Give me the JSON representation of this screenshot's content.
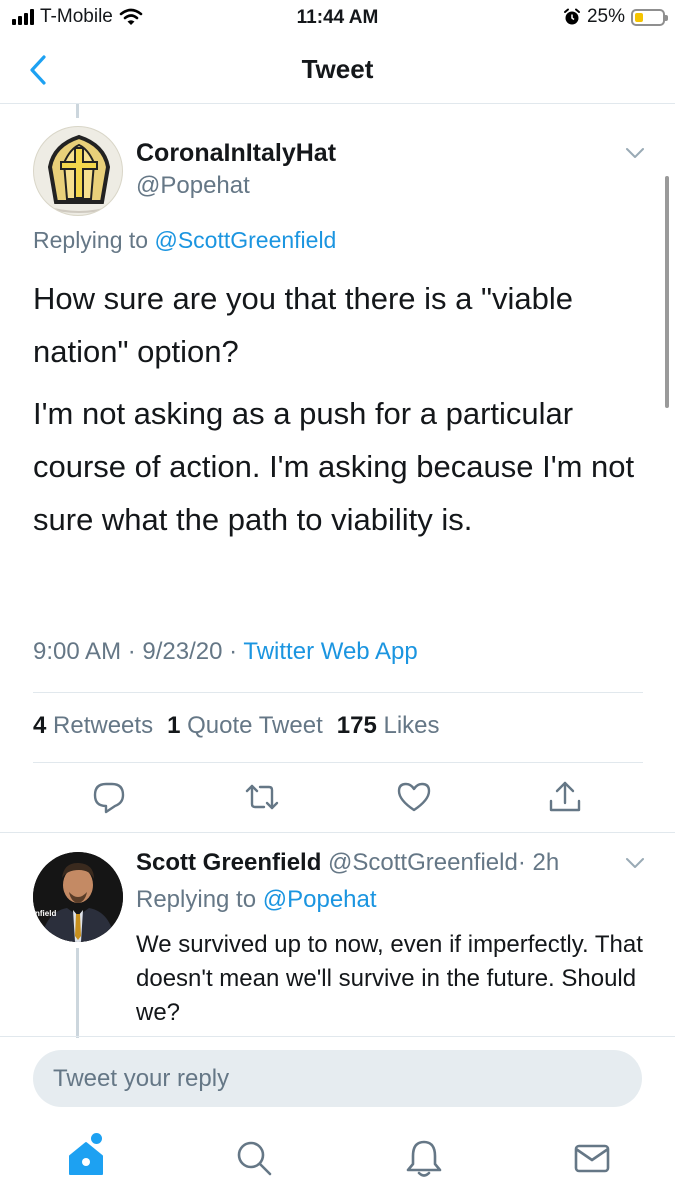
{
  "status_bar": {
    "carrier": "T-Mobile",
    "time": "11:44 AM",
    "battery": "25%",
    "battery_level": 0.25
  },
  "header": {
    "title": "Tweet"
  },
  "main_tweet": {
    "name": "CoronaInItalyHat",
    "handle": "@Popehat",
    "replying_prefix": "Replying to ",
    "replying_to": "@ScottGreenfield",
    "paragraphs": [
      "How sure are you that there is a \"viable nation\" option?",
      "I'm not asking as a push for a particular course of action.  I'm asking because I'm not sure what the path to viability is."
    ],
    "time": "9:00 AM",
    "date": "9/23/20",
    "separator": "·",
    "source": "Twitter Web App",
    "stats": {
      "retweets_count": "4",
      "retweets_label": "Retweets",
      "quotes_count": "1",
      "quotes_label": "Quote Tweet",
      "likes_count": "175",
      "likes_label": "Likes"
    }
  },
  "reply": {
    "name": "Scott Greenfield",
    "handle": "@ScottGreenfield",
    "age": "· 2h",
    "replying_prefix": "Replying to ",
    "replying_to": "@Popehat",
    "text": "We survived up to now, even if imperfectly. That doesn't mean we'll survive in the future. Should we?",
    "avatar_caption": "nfield"
  },
  "compose": {
    "placeholder": "Tweet your reply"
  },
  "icons": {
    "back": "chevron-left-icon",
    "caret": "chevron-down-icon",
    "reply": "reply-icon",
    "retweet": "retweet-icon",
    "like": "heart-icon",
    "share": "share-icon",
    "home": "home-icon",
    "search": "search-icon",
    "notifications": "bell-icon",
    "messages": "mail-icon"
  },
  "colors": {
    "accent": "#1b95e0",
    "secondary_text": "#657786",
    "divider": "#e1e8ed",
    "compose_bg": "#e6ecf0",
    "battery": "#f5c400"
  }
}
